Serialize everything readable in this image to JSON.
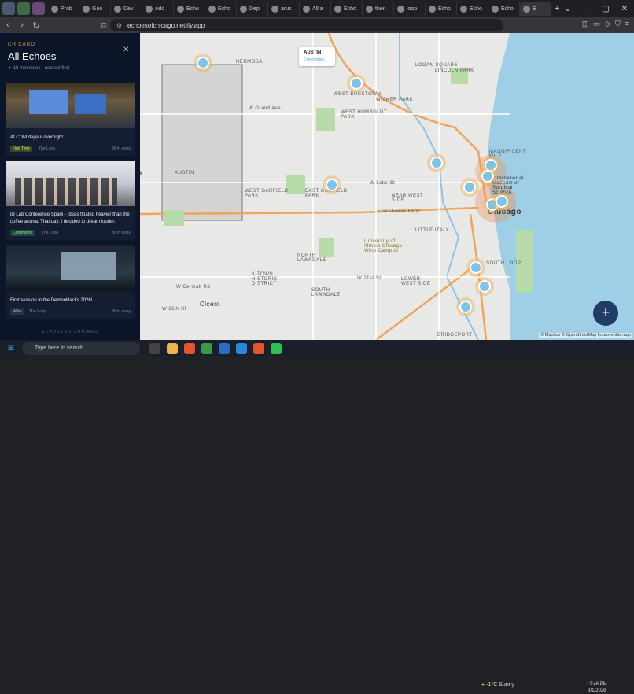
{
  "browser": {
    "tabs": [
      {
        "label": "Prob"
      },
      {
        "label": "Goo"
      },
      {
        "label": "Dev"
      },
      {
        "label": "Add"
      },
      {
        "label": "Echo"
      },
      {
        "label": "Echo"
      },
      {
        "label": "Depl"
      },
      {
        "label": "arus"
      },
      {
        "label": "All a"
      },
      {
        "label": "Echo"
      },
      {
        "label": "then"
      },
      {
        "label": "loop"
      },
      {
        "label": "Echo"
      },
      {
        "label": "Echo"
      },
      {
        "label": "Echo"
      },
      {
        "label": "E"
      }
    ],
    "url": "echoesofchicago.netlify.app"
  },
  "sidebar": {
    "city": "CHICAGO",
    "title": "All Echoes",
    "subtitle": "18 memories · nearest first",
    "footer": "ECHOES OF CHICAGO",
    "cards": [
      {
        "title": "At CDM depaul overnight",
        "tag": "First Time",
        "place": "The Loop",
        "ago": "36 m away"
      },
      {
        "title": "iD Lab Conference Spark - Ideas floated heavier than the coffee aroma. That day, I decided to dream louder.",
        "tag": "Community",
        "place": "The Loop",
        "ago": "36 m away"
      },
      {
        "title": "First session in the DemonHacks 2026!",
        "tag": "Work",
        "place": "The Loop",
        "ago": "36 m away"
      }
    ]
  },
  "map": {
    "popup": {
      "title": "AUSTIN",
      "subtitle": "0 memories"
    },
    "labels": {
      "hermosa": "HERMOSA",
      "logan": "LOGAN SQUARE",
      "lincoln": "LINCOLN PARK",
      "bucktown": "WEST BUCKTOWN",
      "wicker": "WICKER PARK",
      "humboldt": "WEST HUMBOLDT PARK",
      "grand": "W Grand Ave",
      "austin": "AUSTIN",
      "garfield": "WEST GARFIELD PARK",
      "egarfield": "EAST GARFIELD PARK",
      "lake": "W Lake St",
      "nearwest": "NEAR WEST SIDE",
      "eisenhower": "Eisenhower Expy",
      "littleitaly": "LITTLE ITALY",
      "uic": "University of Illinois Chicago West Campus",
      "magmile": "MAGNIFICENT MILE",
      "intl": "International Museum of Surgical Science",
      "chicago": "Chicago",
      "northlawndale": "NORTH LAWNDALE",
      "khistoric": "K-TOWN HISTORIC DISTRICT",
      "southlawndale": "SOUTH LAWNDALE",
      "lowerwest": "LOWER WEST SIDE",
      "southloop": "SOUTH LOOP",
      "cermak": "W Cermak Rd",
      "w21st": "W 21st St",
      "cicero": "Cicero",
      "w26th": "W 26th St",
      "bridgeport": "BRIDGEPORT",
      "k": "k"
    },
    "attribution": "© Mapbox © OpenStreetMap  Improve this map",
    "fab_label": "+"
  },
  "taskbar": {
    "search_placeholder": "Type here to search",
    "weather": "-1°C  Sunny",
    "time": "12:46 PM",
    "date": "3/1/2026"
  },
  "colors": {
    "sidebar_bg": "#0d1628",
    "accent_gold": "#d9a441",
    "marker_blue": "#7cc4ea",
    "fab": "#1f3b66",
    "water": "#9fcfe6"
  }
}
